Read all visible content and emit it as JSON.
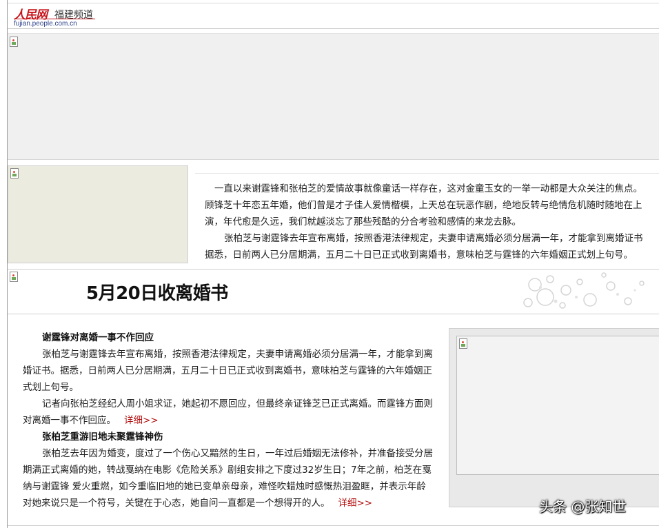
{
  "header": {
    "brand": "人民网",
    "channel": "福建频道",
    "url": "fujian.people.com.cn"
  },
  "intro": {
    "para1_lines": [
      "一直以来谢霆锋和张柏芝的爱情故事就像童话一样存在，这对金童玉女的一举一动都是大众关注的焦点。",
      "顾锋芝十年恋五年婚，他们曾是才子佳人爱情楷模，上天总在玩恶作剧，绝地反转与绝情危机随时随地在上",
      "演，年代愈是久远，我们就越淡忘了那些残酷的分合考验和感情的来龙去脉。"
    ],
    "para2_lines": [
      "张柏芝与谢霆锋去年宣布离婚，按照香港法律规定，夫妻申请离婚必须分居满一年，才能拿到离婚证书",
      "据悉，日前两人已分居期满，五月二十日已正式收到离婚书，意味柏芝与霆锋的六年婚姻正式划上句号。"
    ]
  },
  "section": {
    "title": "5月20日收离婚书"
  },
  "article": {
    "sub1": "谢霆锋对离婚一事不作回应",
    "p1": "张柏芝与谢霆锋去年宣布离婚，按照香港法律规定，夫妻申请离婚必须分居满一年，才能拿到离婚证书。据悉，日前两人已分居期满，五月二十日已正式收到离婚书，意味柏芝与霆锋的六年婚姻正式划上句号。",
    "p2": "记者向张柏芝经纪人周小姐求证，她起初不愿回应，但最终亲证锋芝已正式离婚。而霆锋方面则对离婚一事不作回应。",
    "more1": "详细>>",
    "sub2": "张柏芝重游旧地未聚霆锋神伤",
    "p3": "张柏芝去年因为婚变，度过了一个伤心又黯然的生日，一年过后婚姻无法修补，并准备接受分居期满正式离婚的她，转战戛纳在电影《危险关系》剧组安排之下度过32岁生日；7年之前，柏芝在戛纳与谢霆锋 爱火重燃，如今重临旧地的她已变单亲母亲，难怪吹蜡烛时感慨热泪盈眶，并表示年龄对她来说只是一个符号，关键在于心态，她自问一直都是一个想得开的人。",
    "more2": "详细>>"
  },
  "watermark": "头条 @张知世",
  "colors": {
    "brand_red": "#c8161d",
    "link_red": "#b40f0f",
    "url_blue": "#2b3f8a"
  }
}
